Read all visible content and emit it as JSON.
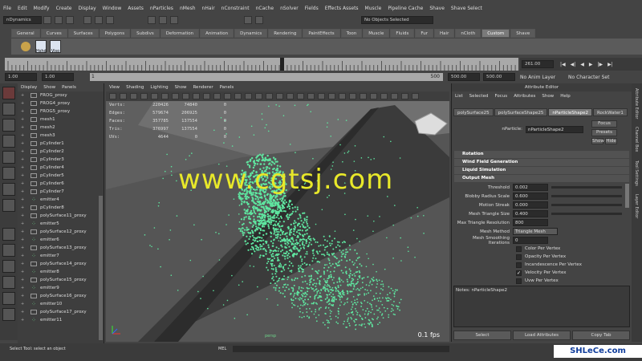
{
  "menubar": [
    "File",
    "Edit",
    "Modify",
    "Create",
    "Display",
    "Window",
    "Assets",
    "nParticles",
    "nMesh",
    "nHair",
    "nConstraint",
    "nCache",
    "nSolver",
    "Fields",
    "Effects Assets",
    "Muscle",
    "Pipeline Cache",
    "Shave",
    "Shave Select"
  ],
  "module": "nDynamics",
  "statusline": {
    "no_objects": "No Objects Selected"
  },
  "shelf_tabs": [
    "General",
    "Curves",
    "Surfaces",
    "Polygons",
    "Subdivs",
    "Deformation",
    "Animation",
    "Dynamics",
    "Rendering",
    "PaintEffects",
    "Toon",
    "Muscle",
    "Fluids",
    "Fur",
    "Hair",
    "nCloth",
    "Custom",
    "Shave"
  ],
  "shelf_active": "Custom",
  "shelf_buttons": [
    "Hshd",
    "Viso"
  ],
  "timeline": {
    "end_label": "261.00"
  },
  "range": {
    "start": "1.00",
    "start2": "1.00",
    "current": "1",
    "end_marker": "500",
    "end": "500.00",
    "end2": "500.00",
    "anim_layer": "No Anim Layer",
    "character": "No Character Set"
  },
  "outliner": {
    "menu": [
      "Display",
      "Show",
      "Panels"
    ],
    "items": [
      {
        "name": "FROG_proxy",
        "type": "mesh"
      },
      {
        "name": "FROG4_proxy",
        "type": "mesh"
      },
      {
        "name": "FROG5_proxy",
        "type": "mesh"
      },
      {
        "name": "mesh1",
        "type": "mesh"
      },
      {
        "name": "mesh2",
        "type": "mesh"
      },
      {
        "name": "mesh3",
        "type": "mesh"
      },
      {
        "name": "pCylinder1",
        "type": "mesh"
      },
      {
        "name": "pCylinder2",
        "type": "mesh"
      },
      {
        "name": "pCylinder3",
        "type": "mesh"
      },
      {
        "name": "pCylinder4",
        "type": "mesh"
      },
      {
        "name": "pCylinder5",
        "type": "mesh"
      },
      {
        "name": "pCylinder6",
        "type": "mesh"
      },
      {
        "name": "pCylinder7",
        "type": "mesh"
      },
      {
        "name": "emitter4",
        "type": "particle"
      },
      {
        "name": "pCylinder8",
        "type": "mesh"
      },
      {
        "name": "polySurface11_proxy",
        "type": "mesh"
      },
      {
        "name": "emitter5",
        "type": "particle"
      },
      {
        "name": "polySurface12_proxy",
        "type": "mesh"
      },
      {
        "name": "emitter6",
        "type": "particle"
      },
      {
        "name": "polySurface13_proxy",
        "type": "mesh"
      },
      {
        "name": "emitter7",
        "type": "particle"
      },
      {
        "name": "polySurface14_proxy",
        "type": "mesh"
      },
      {
        "name": "emitter8",
        "type": "particle"
      },
      {
        "name": "polySurface15_proxy",
        "type": "mesh"
      },
      {
        "name": "emitter9",
        "type": "particle"
      },
      {
        "name": "polySurface16_proxy",
        "type": "mesh"
      },
      {
        "name": "emitter10",
        "type": "particle"
      },
      {
        "name": "polySurface17_proxy",
        "type": "mesh"
      },
      {
        "name": "emitter11",
        "type": "particle"
      }
    ]
  },
  "viewport": {
    "menu": [
      "View",
      "Shading",
      "Lighting",
      "Show",
      "Renderer",
      "Panels"
    ],
    "hud": [
      {
        "k": "Verts:",
        "a": "220426",
        "b": "74840",
        "c": "0"
      },
      {
        "k": "Edges:",
        "a": "579674",
        "b": "206925",
        "c": "0"
      },
      {
        "k": "Faces:",
        "a": "357785",
        "b": "137554",
        "c": "0"
      },
      {
        "k": "Tris:",
        "a": "376997",
        "b": "137554",
        "c": "0"
      },
      {
        "k": "UVs:",
        "a": "4644",
        "b": "0",
        "c": "0"
      }
    ],
    "fps": "0.1 fps",
    "camera": "persp",
    "watermark": "www.cgtsj.com"
  },
  "attr": {
    "title": "Attribute Editor",
    "menu": [
      "List",
      "Selected",
      "Focus",
      "Attributes",
      "Show",
      "Help"
    ],
    "tabs": [
      "polySurface25",
      "polySurfaceShape25",
      "nParticleShape2",
      "RockWater1"
    ],
    "active_tab": "nParticleShape2",
    "node_label": "nParticle:",
    "node_value": "nParticleShape2",
    "focus": "Focus",
    "presets": "Presets",
    "show": "Show",
    "hide": "Hide",
    "sections": [
      "Rotation",
      "Wind Field Generation",
      "Liquid Simulation",
      "Output Mesh"
    ],
    "fields": [
      {
        "label": "Threshold",
        "value": "0.002"
      },
      {
        "label": "Blobby Radius Scale",
        "value": "0.600"
      },
      {
        "label": "Motion Streak",
        "value": "0.000"
      },
      {
        "label": "Mesh Triangle Size",
        "value": "0.400"
      },
      {
        "label": "Max Triangle Resolution",
        "value": "800"
      },
      {
        "label": "Mesh Method",
        "value": "Triangle Mesh"
      },
      {
        "label": "Mesh Smoothing Iterations",
        "value": "0"
      }
    ],
    "checks": [
      {
        "label": "Color Per Vertex",
        "checked": ""
      },
      {
        "label": "Opacity Per Vertex",
        "checked": ""
      },
      {
        "label": "Incandescence Per Vertex",
        "checked": ""
      },
      {
        "label": "Velocity Per Vertex",
        "checked": "✓"
      },
      {
        "label": "Uvw Per Vertex",
        "checked": ""
      }
    ],
    "notes": "Notes: nParticleShape2",
    "buttons": [
      "Select",
      "Load Attributes",
      "Copy Tab"
    ]
  },
  "right_tabs": [
    "Attribute Editor",
    "Channel Box",
    "Tool Settings",
    "Layer Editor"
  ],
  "status": {
    "help": "Select Tool: select an object",
    "mel": "MEL"
  },
  "logo": "SHLeCe.com"
}
